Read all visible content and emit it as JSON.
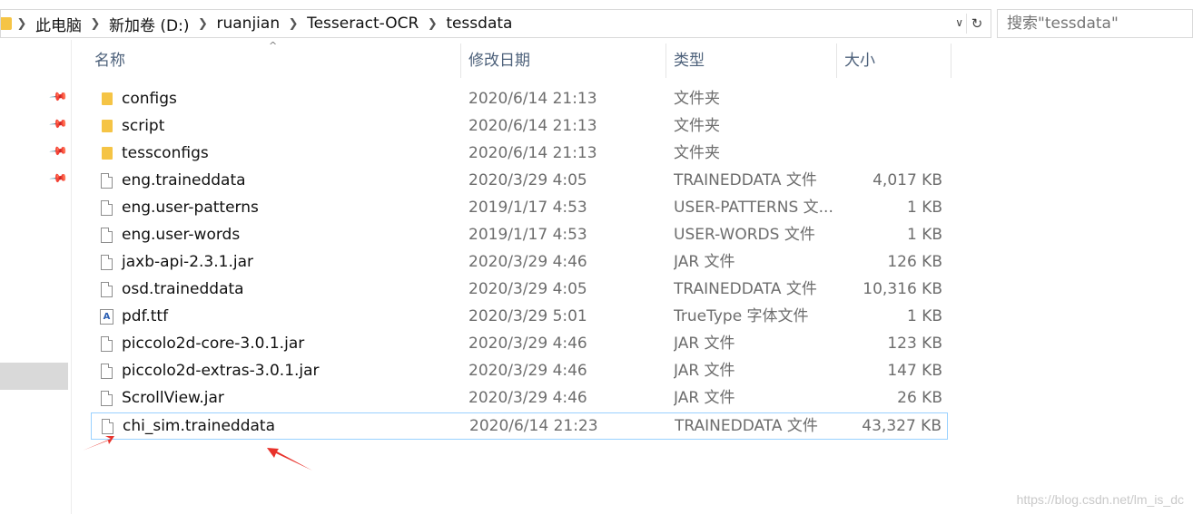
{
  "breadcrumb": [
    "此电脑",
    "新加卷 (D:)",
    "ruanjian",
    "Tesseract-OCR",
    "tessdata"
  ],
  "search": {
    "placeholder": "搜索\"tessdata\""
  },
  "columns": {
    "name": "名称",
    "date": "修改日期",
    "type": "类型",
    "size": "大小"
  },
  "files": [
    {
      "name": "configs",
      "date": "2020/6/14 21:13",
      "type": "文件夹",
      "size": "",
      "icon": "folder-icon"
    },
    {
      "name": "script",
      "date": "2020/6/14 21:13",
      "type": "文件夹",
      "size": "",
      "icon": "folder-icon"
    },
    {
      "name": "tessconfigs",
      "date": "2020/6/14 21:13",
      "type": "文件夹",
      "size": "",
      "icon": "folder-icon"
    },
    {
      "name": "eng.traineddata",
      "date": "2020/3/29 4:05",
      "type": "TRAINEDDATA 文件",
      "size": "4,017 KB",
      "icon": "file-icon"
    },
    {
      "name": "eng.user-patterns",
      "date": "2019/1/17 4:53",
      "type": "USER-PATTERNS 文...",
      "size": "1 KB",
      "icon": "file-icon"
    },
    {
      "name": "eng.user-words",
      "date": "2019/1/17 4:53",
      "type": "USER-WORDS 文件",
      "size": "1 KB",
      "icon": "file-icon"
    },
    {
      "name": "jaxb-api-2.3.1.jar",
      "date": "2020/3/29 4:46",
      "type": "JAR 文件",
      "size": "126 KB",
      "icon": "file-icon"
    },
    {
      "name": "osd.traineddata",
      "date": "2020/3/29 4:05",
      "type": "TRAINEDDATA 文件",
      "size": "10,316 KB",
      "icon": "file-icon"
    },
    {
      "name": "pdf.ttf",
      "date": "2020/3/29 5:01",
      "type": "TrueType 字体文件",
      "size": "1 KB",
      "icon": "font-file-icon"
    },
    {
      "name": "piccolo2d-core-3.0.1.jar",
      "date": "2020/3/29 4:46",
      "type": "JAR 文件",
      "size": "123 KB",
      "icon": "file-icon"
    },
    {
      "name": "piccolo2d-extras-3.0.1.jar",
      "date": "2020/3/29 4:46",
      "type": "JAR 文件",
      "size": "147 KB",
      "icon": "file-icon"
    },
    {
      "name": "ScrollView.jar",
      "date": "2020/3/29 4:46",
      "type": "JAR 文件",
      "size": "26 KB",
      "icon": "file-icon"
    },
    {
      "name": "chi_sim.traineddata",
      "date": "2020/6/14 21:23",
      "type": "TRAINEDDATA 文件",
      "size": "43,327 KB",
      "icon": "file-icon",
      "selected": true
    }
  ],
  "watermark": "https://blog.csdn.net/lm_is_dc",
  "colors": {
    "accent_selection": "#99d1ff",
    "folder": "#f5c445",
    "arrow": "#e8322b",
    "header_text": "#4c607a"
  }
}
